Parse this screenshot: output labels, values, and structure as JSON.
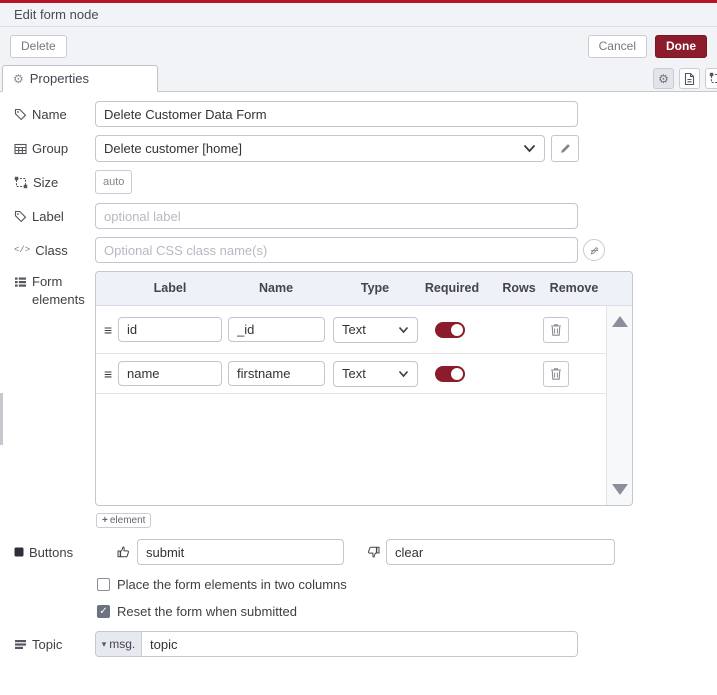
{
  "dialog": {
    "title": "Edit form node",
    "delete_label": "Delete",
    "cancel_label": "Cancel",
    "done_label": "Done"
  },
  "tabs": {
    "properties_label": "Properties"
  },
  "icons": {
    "gear": "⚙",
    "drag_handle": "≡",
    "caret_down": "▾",
    "check": "✓",
    "plus": "+",
    "code": "</>"
  },
  "fields": {
    "name": {
      "label": "Name",
      "value": "Delete Customer Data Form"
    },
    "group": {
      "label": "Group",
      "value": "Delete customer [home]"
    },
    "size": {
      "label": "Size",
      "value": "auto"
    },
    "label": {
      "label": "Label",
      "placeholder": "optional label"
    },
    "css_class": {
      "label": "Class",
      "placeholder": "Optional CSS class name(s)"
    },
    "form_elements": {
      "label": "Form elements"
    },
    "buttons": {
      "label": "Buttons",
      "submit_value": "submit",
      "clear_value": "clear"
    },
    "options": {
      "two_columns": {
        "label": "Place the form elements in two columns",
        "checked": false
      },
      "reset": {
        "label": "Reset the form when submitted",
        "checked": true
      }
    },
    "topic": {
      "label": "Topic",
      "prefix": "msg.",
      "value": "topic"
    }
  },
  "elements_table": {
    "headers": [
      "Label",
      "Name",
      "Type",
      "Required",
      "Rows",
      "Remove"
    ],
    "rows": [
      {
        "label": "id",
        "name": "_id",
        "type": "Text",
        "required": true
      },
      {
        "label": "name",
        "name": "firstname",
        "type": "Text",
        "required": true
      }
    ],
    "add_button_label": "element"
  },
  "colors": {
    "accent_red": "#8C1B2B",
    "top_strip_red": "#B5152B",
    "panel_bg": "#F2F3F6",
    "table_header_bg": "#EEF1F8",
    "toggle_on": "#8C1B2B"
  }
}
